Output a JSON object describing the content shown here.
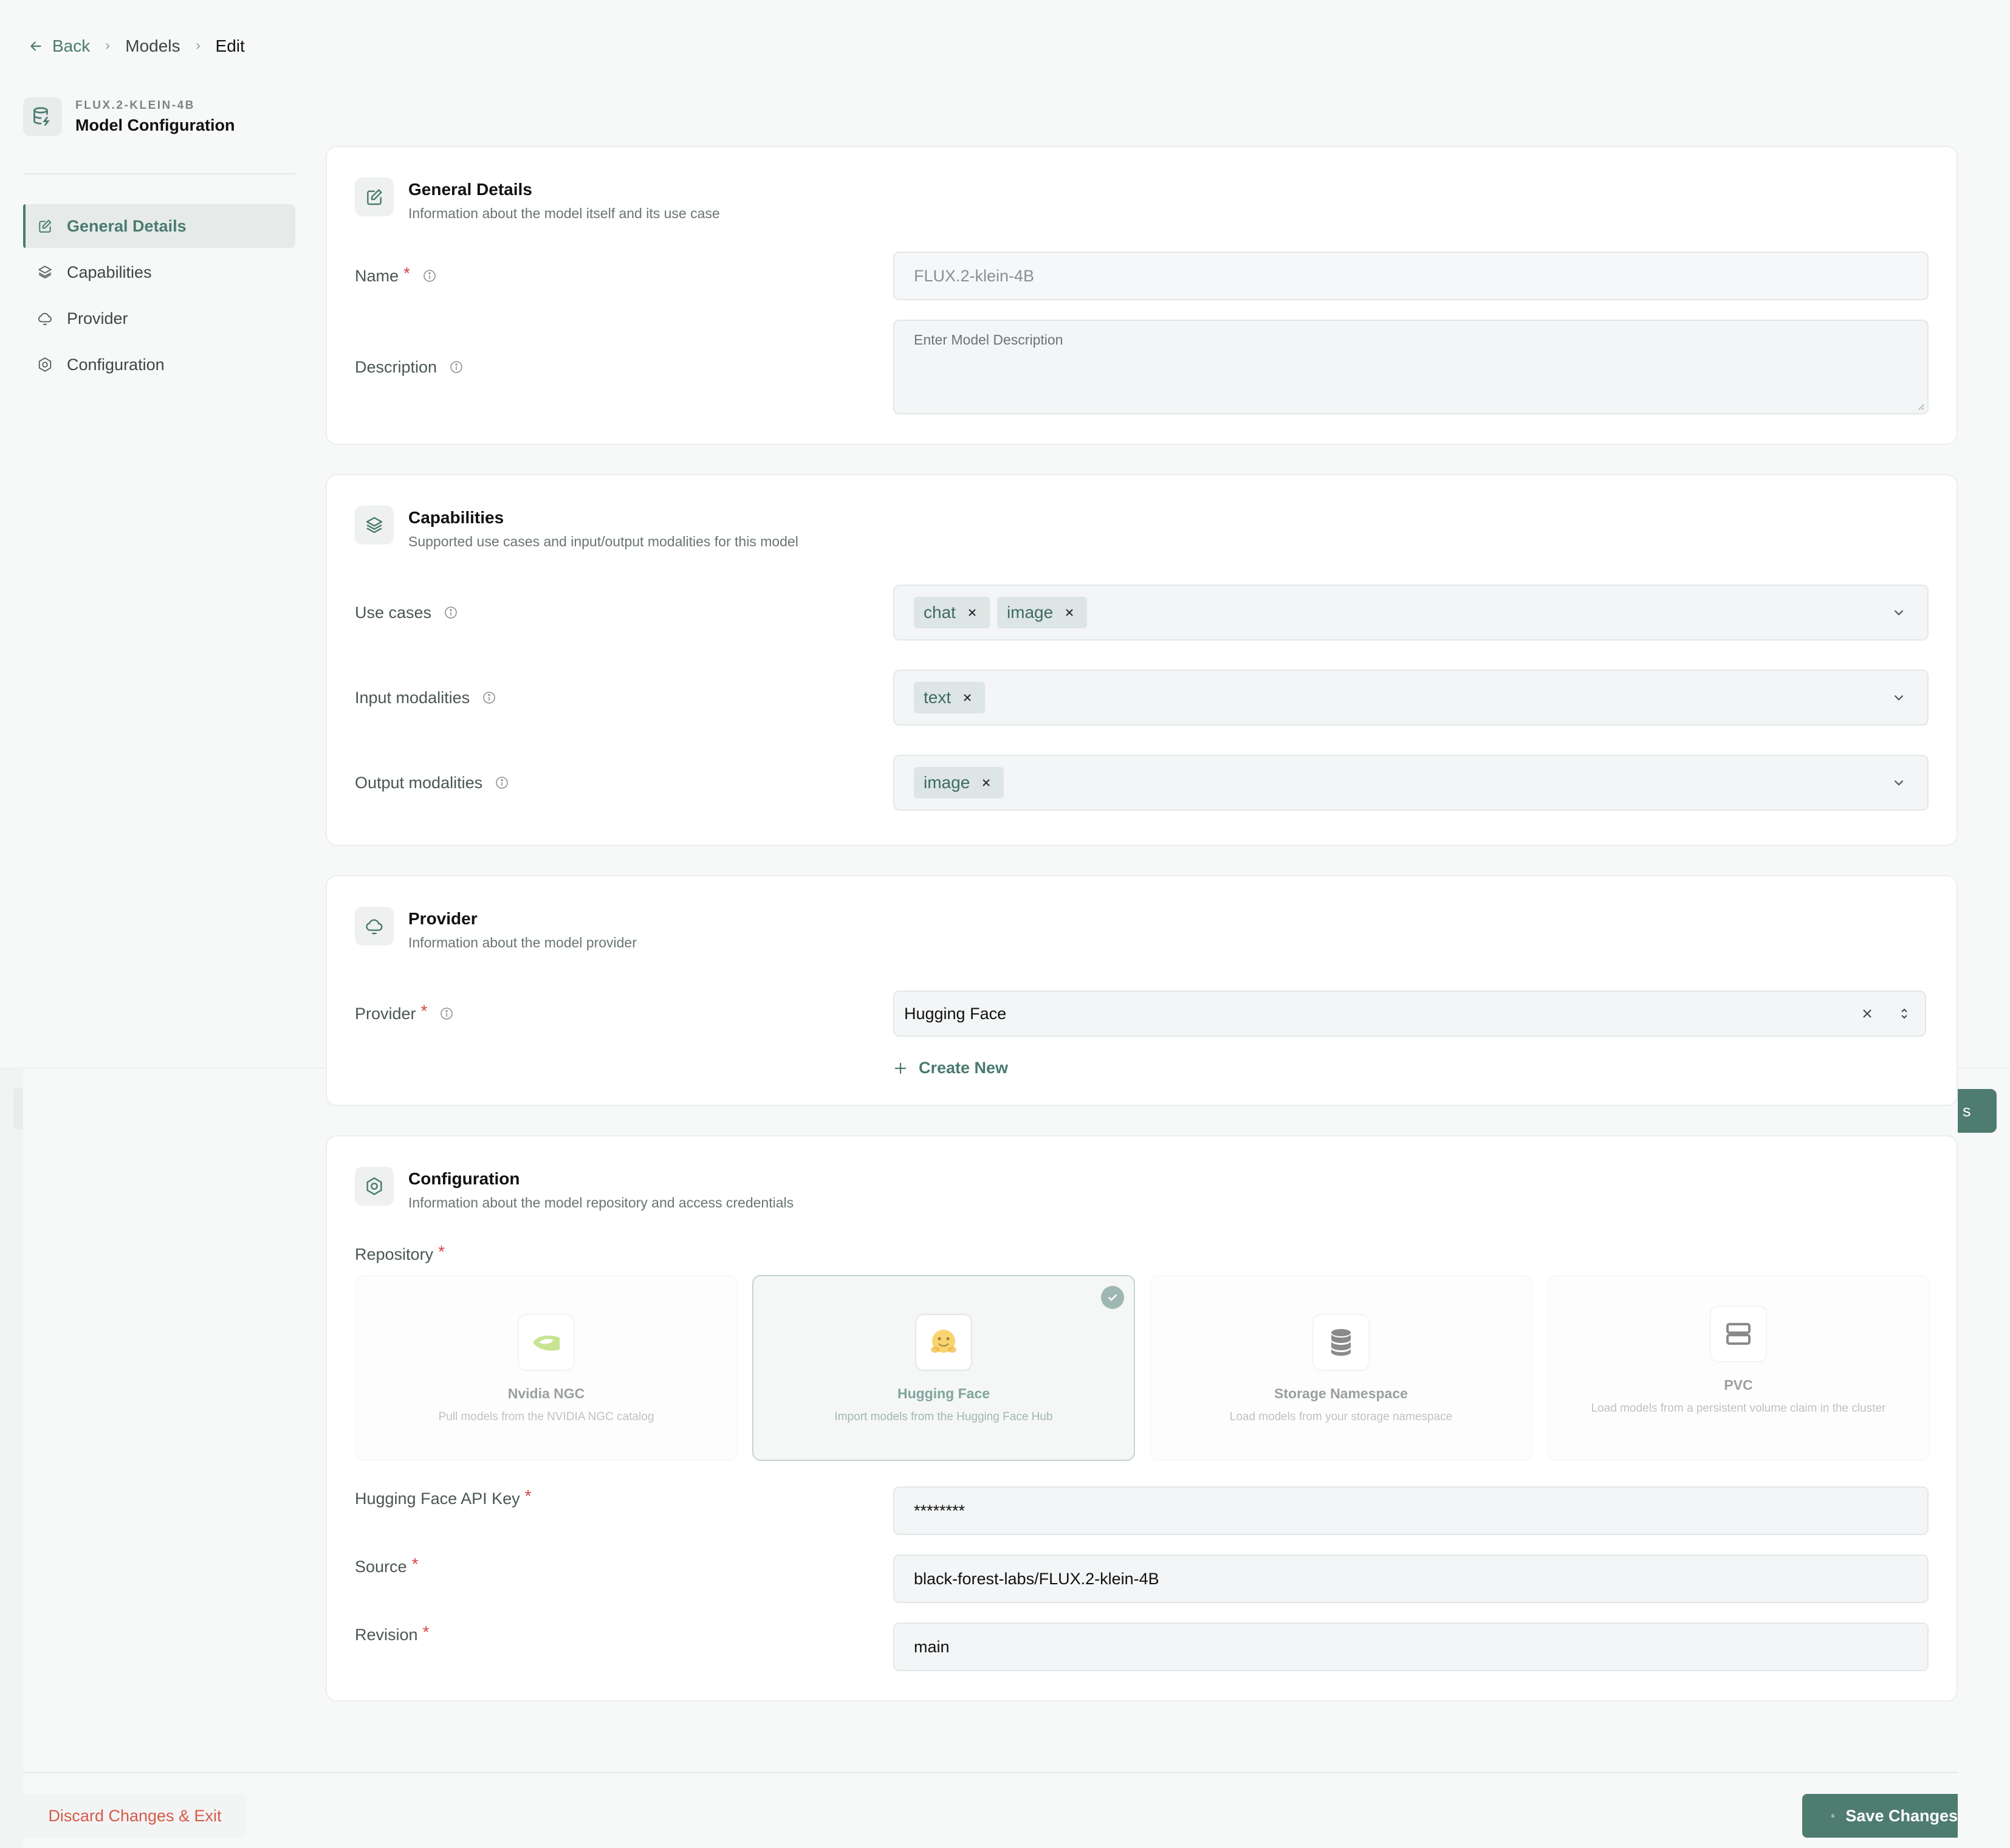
{
  "breadcrumb": {
    "back": "Back",
    "models": "Models",
    "current": "Edit"
  },
  "model": {
    "kicker": "FLUX.2-KLEIN-4B",
    "title": "Model Configuration"
  },
  "sidebar": {
    "items": [
      {
        "label": "General Details",
        "icon": "edit-icon",
        "active": true
      },
      {
        "label": "Capabilities",
        "icon": "layers-icon"
      },
      {
        "label": "Provider",
        "icon": "cloud-icon"
      },
      {
        "label": "Configuration",
        "icon": "settings-icon"
      }
    ]
  },
  "general": {
    "title": "General Details",
    "subtitle": "Information about the model itself and its use case",
    "name_label": "Name",
    "name_value": "FLUX.2-klein-4B",
    "description_label": "Description",
    "description_placeholder": "Enter Model Description"
  },
  "capabilities": {
    "title": "Capabilities",
    "subtitle": "Supported use cases and input/output modalities for this model",
    "use_cases_label": "Use cases",
    "use_cases": [
      "chat",
      "image"
    ],
    "input_label": "Input modalities",
    "input": [
      "text"
    ],
    "output_label": "Output modalities",
    "output": [
      "image"
    ]
  },
  "provider": {
    "title": "Provider",
    "subtitle": "Information about the model provider",
    "label": "Provider",
    "value": "Hugging Face",
    "create_new": "Create New"
  },
  "configuration": {
    "title": "Configuration",
    "subtitle": "Information about the model repository and access credentials",
    "repository_label": "Repository",
    "repos": [
      {
        "name": "Nvidia NGC",
        "desc": "Pull models from the NVIDIA NGC catalog"
      },
      {
        "name": "Hugging Face",
        "desc": "Import models from the Hugging Face Hub",
        "selected": true
      },
      {
        "name": "Storage Namespace",
        "desc": "Load models from your storage namespace"
      },
      {
        "name": "PVC",
        "desc": "Load models from a persistent volume claim in the cluster"
      }
    ],
    "api_key_label": "Hugging Face API Key",
    "api_key_value": "********",
    "source_label": "Source",
    "source_value": "black-forest-labs/FLUX.2-klein-4B",
    "revision_label": "Revision",
    "revision_value": "main"
  },
  "footer": {
    "discard": "Discard Changes & Exit",
    "save": "Save Changes",
    "ghost_save_fragment": "s"
  },
  "colors": {
    "accent": "#4a7a6e",
    "danger": "#d64545",
    "tag_bg": "#dde6e4"
  }
}
